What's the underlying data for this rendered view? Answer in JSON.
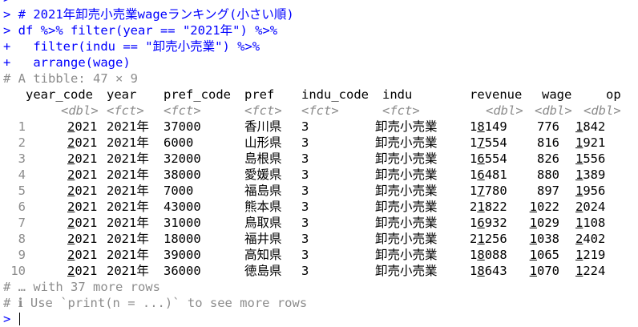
{
  "console": {
    "line0": ">",
    "comment_prefix": "> ",
    "comment": "# 2021年卸売小売業wageランキング(小さい順)",
    "cmd1_prefix": "> ",
    "cmd1": "df %>% filter(year == \"2021年\") %>%",
    "cmd2_prefix": "+ ",
    "cmd2": "  filter(indu == \"卸売小売業\") %>%",
    "cmd3_prefix": "+ ",
    "cmd3": "  arrange(wage)",
    "tibble_header": "# A tibble: 47 × 9",
    "more_rows": "# … with 37 more rows",
    "hint_prefix": "# ",
    "hint_icon": "ℹ",
    "hint": " Use `print(n = ...)` to see more rows",
    "prompt": "> "
  },
  "table": {
    "columns": [
      "year_code",
      "year",
      "pref_code",
      "pref",
      "indu_code",
      "indu",
      "revenue",
      "wage",
      "op"
    ],
    "types": [
      "<dbl>",
      "<fct>",
      "<fct>",
      "<fct>",
      "<fct>",
      "<fct>",
      "<dbl>",
      "<dbl>",
      "<dbl>"
    ],
    "rows": [
      {
        "n": "1",
        "year_code": "2021",
        "year": "2021年",
        "pref_code": "37000",
        "pref": "香川県",
        "indu_code": "3",
        "indu": "卸売小売業",
        "revenue": "18149",
        "wage": "776",
        "op": "1842"
      },
      {
        "n": "2",
        "year_code": "2021",
        "year": "2021年",
        "pref_code": "6000",
        "pref": "山形県",
        "indu_code": "3",
        "indu": "卸売小売業",
        "revenue": "17554",
        "wage": "816",
        "op": "1921"
      },
      {
        "n": "3",
        "year_code": "2021",
        "year": "2021年",
        "pref_code": "32000",
        "pref": "島根県",
        "indu_code": "3",
        "indu": "卸売小売業",
        "revenue": "16554",
        "wage": "826",
        "op": "1556"
      },
      {
        "n": "4",
        "year_code": "2021",
        "year": "2021年",
        "pref_code": "38000",
        "pref": "愛媛県",
        "indu_code": "3",
        "indu": "卸売小売業",
        "revenue": "16481",
        "wage": "880",
        "op": "1389"
      },
      {
        "n": "5",
        "year_code": "2021",
        "year": "2021年",
        "pref_code": "7000",
        "pref": "福島県",
        "indu_code": "3",
        "indu": "卸売小売業",
        "revenue": "17780",
        "wage": "897",
        "op": "1956"
      },
      {
        "n": "6",
        "year_code": "2021",
        "year": "2021年",
        "pref_code": "43000",
        "pref": "熊本県",
        "indu_code": "3",
        "indu": "卸売小売業",
        "revenue": "21822",
        "wage": "1022",
        "op": "2024"
      },
      {
        "n": "7",
        "year_code": "2021",
        "year": "2021年",
        "pref_code": "31000",
        "pref": "鳥取県",
        "indu_code": "3",
        "indu": "卸売小売業",
        "revenue": "16932",
        "wage": "1029",
        "op": "1108"
      },
      {
        "n": "8",
        "year_code": "2021",
        "year": "2021年",
        "pref_code": "18000",
        "pref": "福井県",
        "indu_code": "3",
        "indu": "卸売小売業",
        "revenue": "21256",
        "wage": "1038",
        "op": "2402"
      },
      {
        "n": "9",
        "year_code": "2021",
        "year": "2021年",
        "pref_code": "39000",
        "pref": "高知県",
        "indu_code": "3",
        "indu": "卸売小売業",
        "revenue": "18088",
        "wage": "1065",
        "op": "1219"
      },
      {
        "n": "10",
        "year_code": "2021",
        "year": "2021年",
        "pref_code": "36000",
        "pref": "徳島県",
        "indu_code": "3",
        "indu": "卸売小売業",
        "revenue": "18643",
        "wage": "1070",
        "op": "1224"
      }
    ]
  }
}
